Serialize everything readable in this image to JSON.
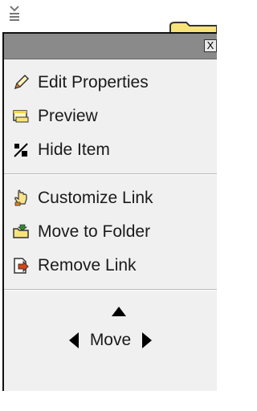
{
  "menu": {
    "close_label": "X",
    "group1": [
      {
        "label": "Edit Properties",
        "icon": "pencil-icon"
      },
      {
        "label": "Preview",
        "icon": "preview-window-icon"
      },
      {
        "label": "Hide Item",
        "icon": "hide-item-icon"
      }
    ],
    "group2": [
      {
        "label": "Customize Link",
        "icon": "customize-hand-icon"
      },
      {
        "label": "Move to Folder",
        "icon": "folder-move-icon"
      },
      {
        "label": "Remove Link",
        "icon": "remove-link-icon"
      }
    ],
    "move": {
      "label": "Move"
    }
  },
  "colors": {
    "menu_bg": "#f0f0f0",
    "header_bg": "#8a8a8a",
    "folder_yellow": "#f7e37a",
    "icon_orange": "#e67e22"
  }
}
